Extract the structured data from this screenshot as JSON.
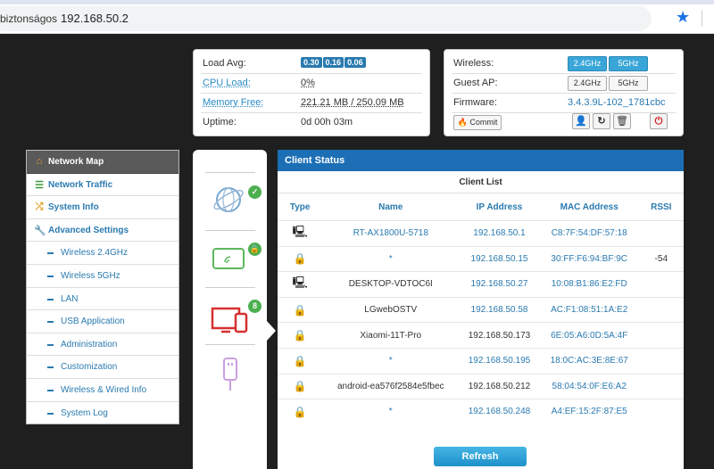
{
  "browser": {
    "security_label": "biztonságos",
    "url": "192.168.50.2",
    "star_icon": "star-icon"
  },
  "status": {
    "load_avg_label": "Load Avg:",
    "load_avg": [
      "0.30",
      "0.16",
      "0.06"
    ],
    "cpu_label": "CPU Load:",
    "cpu_value": "0%",
    "memory_label": "Memory Free:",
    "memory_value": "221.21 MB / 250.09 MB",
    "uptime_label": "Uptime:",
    "uptime_value": "0d 00h 03m"
  },
  "wireless": {
    "wireless_label": "Wireless:",
    "btn_24": "2.4GHz",
    "btn_5": "5GHz",
    "guest_label": "Guest AP:",
    "guest_24": "2.4GHz",
    "guest_5": "5GHz",
    "firmware_label": "Firmware:",
    "firmware_value": "3.4.3.9L-102_1781cbc",
    "commit_label": "Commit"
  },
  "sidebar": {
    "items": [
      {
        "label": "Network Map",
        "icon": "home-icon"
      },
      {
        "label": "Network Traffic",
        "icon": "traffic-icon"
      },
      {
        "label": "System Info",
        "icon": "shuffle-icon"
      },
      {
        "label": "Advanced Settings",
        "icon": "wrench-icon"
      },
      {
        "label": "Wireless 2.4GHz"
      },
      {
        "label": "Wireless 5GHz"
      },
      {
        "label": "LAN"
      },
      {
        "label": "USB Application"
      },
      {
        "label": "Administration"
      },
      {
        "label": "Customization"
      },
      {
        "label": "Wireless & Wired Info"
      },
      {
        "label": "System Log"
      }
    ]
  },
  "iconcol": {
    "clients_count": "8"
  },
  "client_status": {
    "title": "Client Status",
    "subtitle": "Client List",
    "columns": [
      "Type",
      "Name",
      "IP Address",
      "MAC Address",
      "RSSI"
    ],
    "rows": [
      {
        "type": "monitor-icon",
        "name": "RT-AX1800U-5718",
        "ip": "192.168.50.1",
        "mac": "C8:7F:54:DF:57:18",
        "rssi": ""
      },
      {
        "type": "lock-icon",
        "name": "*",
        "ip": "192.168.50.15",
        "mac": "30:FF:F6:94:BF:9C",
        "rssi": "-54"
      },
      {
        "type": "monitor-icon",
        "name": "DESKTOP-VDTOC6I",
        "ip": "192.168.50.27",
        "mac": "10:08:B1:86:E2:FD",
        "rssi": ""
      },
      {
        "type": "lock-icon",
        "name": "LGwebOSTV",
        "ip": "192.168.50.58",
        "mac": "AC:F1:08:51:1A:E2",
        "rssi": ""
      },
      {
        "type": "lock-icon",
        "name": "Xiaomi-11T-Pro",
        "ip": "192.168.50.173",
        "mac": "6E:05:A6:0D:5A:4F",
        "rssi": ""
      },
      {
        "type": "lock-icon",
        "name": "*",
        "ip": "192.168.50.195",
        "mac": "18:0C:AC:3E:8E:67",
        "rssi": ""
      },
      {
        "type": "lock-icon",
        "name": "android-ea576f2584e5fbec",
        "ip": "192.168.50.212",
        "mac": "58:04:54:0F:E6:A2",
        "rssi": ""
      },
      {
        "type": "lock-icon",
        "name": "*",
        "ip": "192.168.50.248",
        "mac": "A4:EF:15:2F:87:E5",
        "rssi": ""
      }
    ],
    "refresh_label": "Refresh"
  }
}
